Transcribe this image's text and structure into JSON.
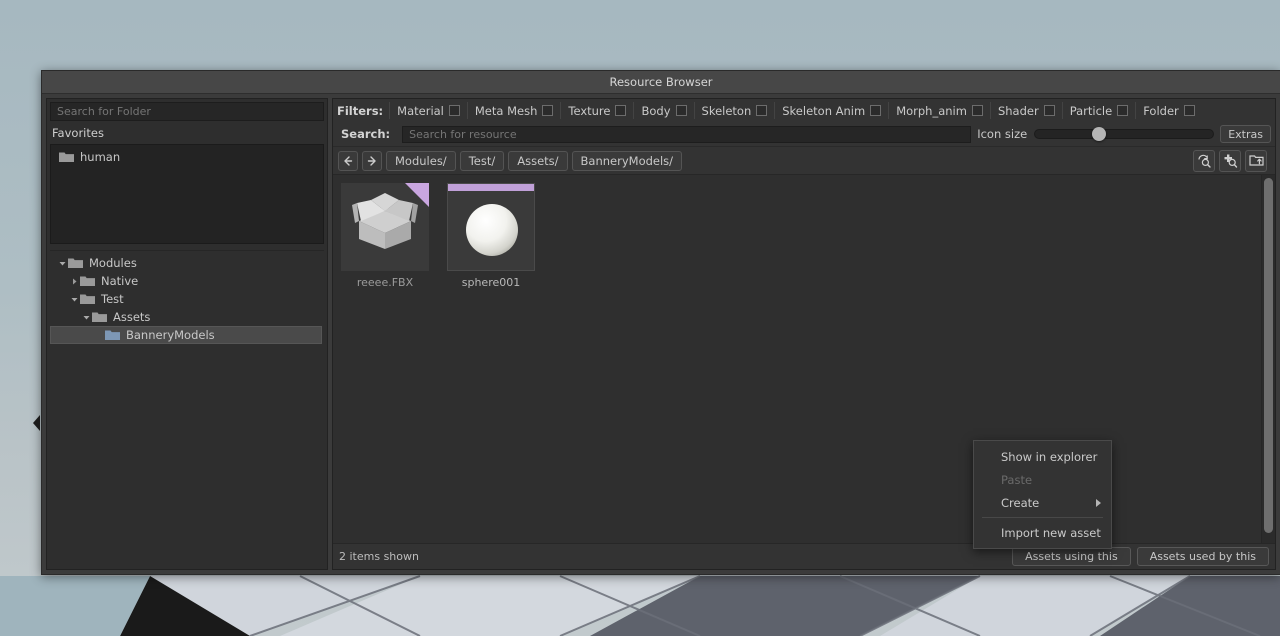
{
  "window": {
    "title": "Resource Browser"
  },
  "left_panel": {
    "folder_search_placeholder": "Search for Folder",
    "favorites_label": "Favorites",
    "favorites": [
      {
        "label": "human",
        "icon": "folder-icon"
      }
    ],
    "tree": [
      {
        "label": "Modules",
        "depth": 0,
        "caret": "down",
        "icon": "folder-icon",
        "selected": false
      },
      {
        "label": "Native",
        "depth": 1,
        "caret": "right",
        "icon": "folder-icon",
        "selected": false
      },
      {
        "label": "Test",
        "depth": 1,
        "caret": "down",
        "icon": "folder-icon",
        "selected": false
      },
      {
        "label": "Assets",
        "depth": 2,
        "caret": "down",
        "icon": "folder-icon",
        "selected": false
      },
      {
        "label": "BanneryModels",
        "depth": 3,
        "caret": "none",
        "icon": "folder-open-icon",
        "selected": true
      }
    ]
  },
  "filters": {
    "label": "Filters:",
    "items": [
      {
        "label": "Material",
        "checked": false
      },
      {
        "label": "Meta Mesh",
        "checked": false
      },
      {
        "label": "Texture",
        "checked": false
      },
      {
        "label": "Body",
        "checked": false
      },
      {
        "label": "Skeleton",
        "checked": false
      },
      {
        "label": "Skeleton Anim",
        "checked": false
      },
      {
        "label": "Morph_anim",
        "checked": false
      },
      {
        "label": "Shader",
        "checked": false
      },
      {
        "label": "Particle",
        "checked": false
      },
      {
        "label": "Folder",
        "checked": false
      }
    ]
  },
  "search": {
    "label": "Search:",
    "placeholder": "Search for resource",
    "value": "",
    "icon_size_label": "Icon size",
    "icon_size_percent": 36,
    "extras_label": "Extras"
  },
  "nav": {
    "back_icon": "arrow-left-icon",
    "forward_icon": "arrow-right-icon",
    "breadcrumbs": [
      "Modules/",
      "Test/",
      "Assets/",
      "BanneryModels/"
    ],
    "tools": [
      {
        "icon": "refresh-search-icon"
      },
      {
        "icon": "add-search-icon"
      },
      {
        "icon": "folder-upload-icon"
      }
    ]
  },
  "assets": [
    {
      "label": "reeee.FBX",
      "thumb": "fbx-package-icon",
      "tag": "corner",
      "tag_color": "#c9a6e0",
      "dim_label": true
    },
    {
      "label": "sphere001",
      "thumb": "sphere-icon",
      "tag": "topbar",
      "tag_color": "#c0a0d8",
      "dim_label": false
    }
  ],
  "context_menu": {
    "items": [
      {
        "label": "Show in explorer",
        "disabled": false,
        "submenu": false,
        "separator_after": false
      },
      {
        "label": "Paste",
        "disabled": true,
        "submenu": false,
        "separator_after": false
      },
      {
        "label": "Create",
        "disabled": false,
        "submenu": true,
        "separator_after": true
      },
      {
        "label": "Import new asset",
        "disabled": false,
        "submenu": false,
        "separator_after": false
      }
    ]
  },
  "status": {
    "items_shown": "2 items shown",
    "assets_using_this": "Assets using this",
    "assets_used_by_this": "Assets used by this"
  },
  "colors": {
    "accent_purple": "#c0a0d8",
    "window_bg": "#3b3b3b",
    "panel_bg": "#2e2e2e",
    "selection": "#4a4a4a",
    "sky_top": "#a6b8c0",
    "sky_bottom": "#c2cacd"
  }
}
